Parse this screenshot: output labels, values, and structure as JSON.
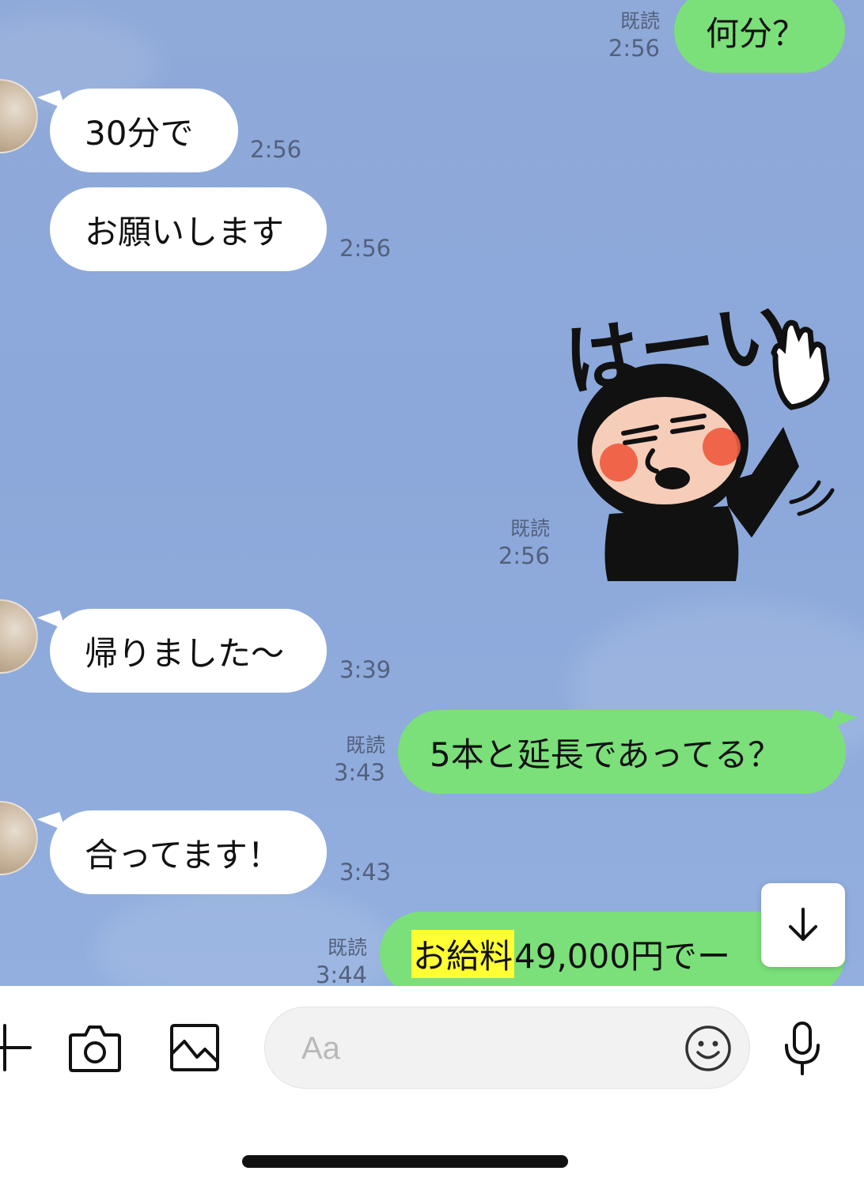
{
  "messages": {
    "m1": {
      "text": "何分？",
      "read": "既読",
      "time": "2:56"
    },
    "m2": {
      "text": "30分で",
      "time": "2:56"
    },
    "m3": {
      "text": "お願いします",
      "time": "2:56"
    },
    "sticker": {
      "text": "はーい",
      "read": "既読",
      "time": "2:56"
    },
    "m5": {
      "text": "帰りました〜",
      "time": "3:39"
    },
    "m6": {
      "text": "5本と延長であってる？",
      "read": "既読",
      "time": "3:43"
    },
    "m7": {
      "text": "合ってます！",
      "time": "3:43"
    },
    "m8": {
      "highlight": "お給料",
      "text": "49,000円でー",
      "read": "既読",
      "time": "3:44"
    }
  },
  "composer": {
    "placeholder": "Aa"
  },
  "icons": {
    "plus": "plus-icon",
    "camera": "camera-icon",
    "image": "image-icon",
    "emoji": "emoji-icon",
    "mic": "microphone-icon",
    "scroll": "arrow-down-icon"
  },
  "colors": {
    "background": "#8fa9d9",
    "outgoing_bubble": "#7be07a",
    "incoming_bubble": "#ffffff",
    "highlight": "#ffff33"
  }
}
